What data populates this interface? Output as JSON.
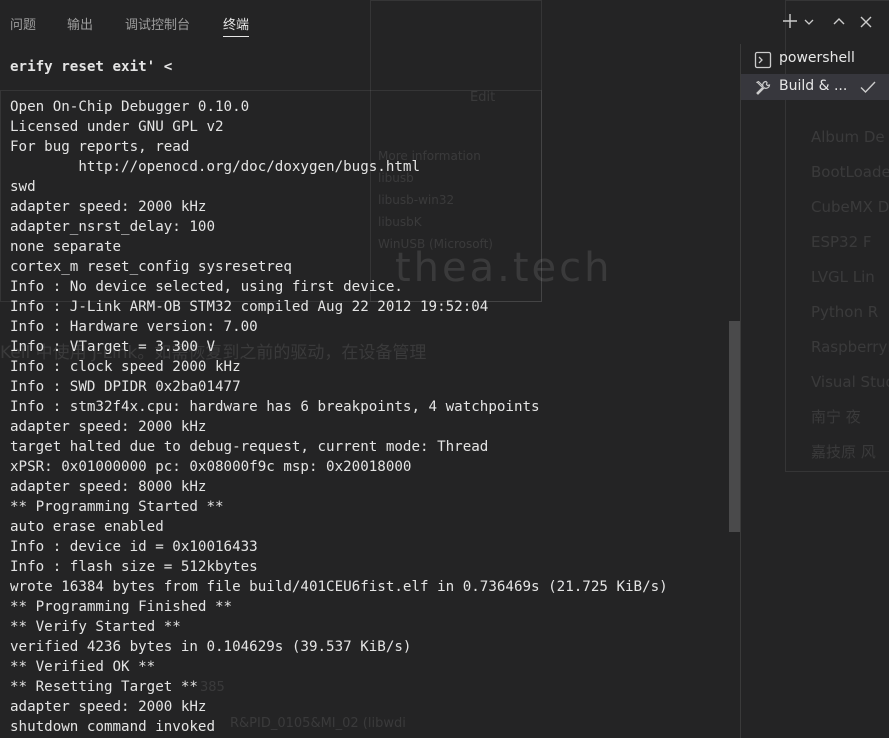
{
  "panel_tabs": [
    {
      "label": "问题"
    },
    {
      "label": "输出"
    },
    {
      "label": "调试控制台"
    },
    {
      "label": "终端"
    }
  ],
  "toolbar": {
    "new_terminal_icon": "plus-icon",
    "dropdown_icon": "chevron-down-icon",
    "maximize_icon": "chevron-up-icon",
    "close_icon": "close-icon"
  },
  "terminal_lines": [
    {
      "text": "erify reset exit' <",
      "bold": true
    },
    {
      "text": "",
      "bold": false
    },
    {
      "text": "Open On-Chip Debugger 0.10.0",
      "bold": false
    },
    {
      "text": "Licensed under GNU GPL v2",
      "bold": false
    },
    {
      "text": "For bug reports, read",
      "bold": false
    },
    {
      "text": "        http://openocd.org/doc/doxygen/bugs.html",
      "bold": false
    },
    {
      "text": "swd",
      "bold": false
    },
    {
      "text": "adapter speed: 2000 kHz",
      "bold": false
    },
    {
      "text": "adapter_nsrst_delay: 100",
      "bold": false
    },
    {
      "text": "none separate",
      "bold": false
    },
    {
      "text": "cortex_m reset_config sysresetreq",
      "bold": false
    },
    {
      "text": "Info : No device selected, using first device.",
      "bold": false
    },
    {
      "text": "Info : J-Link ARM-OB STM32 compiled Aug 22 2012 19:52:04",
      "bold": false
    },
    {
      "text": "Info : Hardware version: 7.00",
      "bold": false
    },
    {
      "text": "Info : VTarget = 3.300 V",
      "bold": false
    },
    {
      "text": "Info : clock speed 2000 kHz",
      "bold": false
    },
    {
      "text": "Info : SWD DPIDR 0x2ba01477",
      "bold": false
    },
    {
      "text": "Info : stm32f4x.cpu: hardware has 6 breakpoints, 4 watchpoints",
      "bold": false
    },
    {
      "text": "adapter speed: 2000 kHz",
      "bold": false
    },
    {
      "text": "target halted due to debug-request, current mode: Thread",
      "bold": false
    },
    {
      "text": "xPSR: 0x01000000 pc: 0x08000f9c msp: 0x20018000",
      "bold": false
    },
    {
      "text": "adapter speed: 8000 kHz",
      "bold": false
    },
    {
      "text": "** Programming Started **",
      "bold": false
    },
    {
      "text": "auto erase enabled",
      "bold": false
    },
    {
      "text": "Info : device id = 0x10016433",
      "bold": false
    },
    {
      "text": "Info : flash size = 512kbytes",
      "bold": false
    },
    {
      "text": "wrote 16384 bytes from file build/401CEU6fist.elf in 0.736469s (21.725 KiB/s)",
      "bold": false
    },
    {
      "text": "** Programming Finished **",
      "bold": false
    },
    {
      "text": "** Verify Started **",
      "bold": false
    },
    {
      "text": "verified 4236 bytes in 0.104629s (39.537 KiB/s)",
      "bold": false
    },
    {
      "text": "** Verified OK **",
      "bold": false
    },
    {
      "text": "** Resetting Target **",
      "bold": false
    },
    {
      "text": "adapter speed: 2000 kHz",
      "bold": false
    },
    {
      "text": "shutdown command invoked",
      "bold": false
    }
  ],
  "terminal_list": [
    {
      "label": "powershell",
      "icon": "terminal-icon",
      "selected": false
    },
    {
      "label": "Build & ...",
      "icon": "tools-icon",
      "selected": true,
      "check_icon": "check-icon"
    }
  ],
  "colors": {
    "background": "#242425",
    "text": "#e4e4e4",
    "tab_inactive": "#9d9d9d",
    "tab_active": "#e7e7e7",
    "selected_item": "#37373d"
  }
}
